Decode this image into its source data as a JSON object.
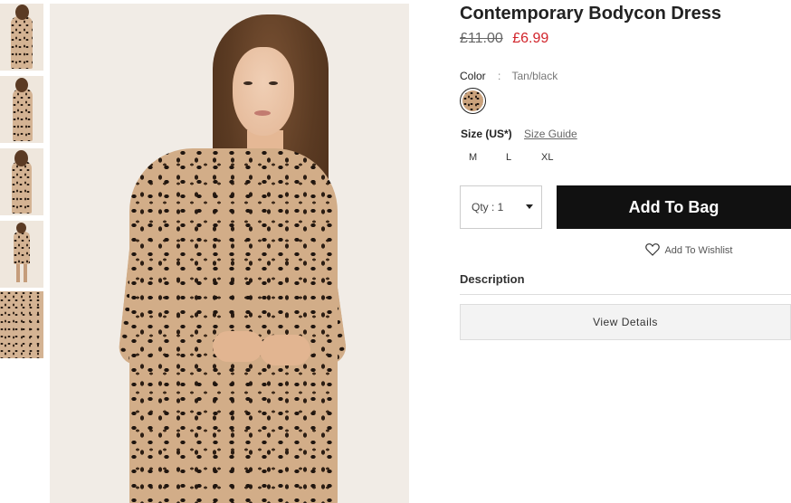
{
  "product": {
    "title": "Contemporary Bodycon Dress",
    "price_original": "£11.00",
    "price_sale": "£6.99"
  },
  "color": {
    "label": "Color",
    "separator": ":",
    "value": "Tan/black",
    "swatch_pattern": "leopard-print"
  },
  "size": {
    "label": "Size (US*)",
    "guide_link": "Size Guide",
    "options": [
      "M",
      "L",
      "XL"
    ]
  },
  "quantity": {
    "label": "Qty : 1"
  },
  "actions": {
    "add_to_bag": "Add To Bag",
    "wishlist": "Add To Wishlist",
    "wishlist_icon": "heart-outline-icon"
  },
  "description": {
    "heading": "Description",
    "view_details": "View Details"
  },
  "colors": {
    "sale_price": "#d1232a",
    "button_bg": "#111111",
    "button_text": "#ffffff"
  },
  "gallery": {
    "thumbnail_count": 5
  }
}
